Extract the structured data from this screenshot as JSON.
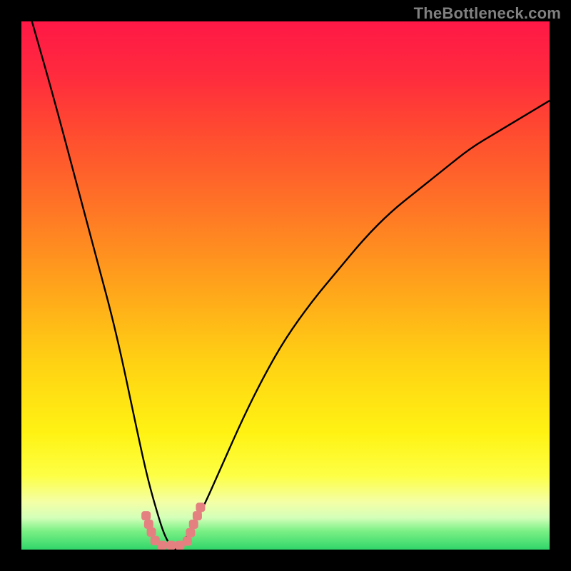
{
  "watermark": "TheBottleneck.com",
  "colors": {
    "frame": "#000000",
    "curve": "#000000",
    "marker": "#e58080",
    "bottom_band": "#31d66b",
    "gradient_stops": [
      {
        "offset": "0%",
        "color": "#ff1846"
      },
      {
        "offset": "10%",
        "color": "#ff2a3e"
      },
      {
        "offset": "20%",
        "color": "#ff4831"
      },
      {
        "offset": "35%",
        "color": "#ff7426"
      },
      {
        "offset": "50%",
        "color": "#ffa31b"
      },
      {
        "offset": "65%",
        "color": "#ffd313"
      },
      {
        "offset": "78%",
        "color": "#fff313"
      },
      {
        "offset": "86%",
        "color": "#fdff45"
      },
      {
        "offset": "91%",
        "color": "#f4ffa6"
      },
      {
        "offset": "94%",
        "color": "#d3ffb9"
      },
      {
        "offset": "96.5%",
        "color": "#7af084"
      },
      {
        "offset": "100%",
        "color": "#31d66b"
      }
    ]
  },
  "chart_data": {
    "type": "line",
    "title": "",
    "xlabel": "",
    "ylabel": "",
    "xlim": [
      0,
      100
    ],
    "ylim": [
      0,
      100
    ],
    "grid": false,
    "series": [
      {
        "name": "bottleneck-curve",
        "x": [
          2,
          6,
          10,
          14,
          18,
          22,
          24,
          26,
          27,
          28,
          29,
          30,
          31,
          34,
          38,
          42,
          46,
          50,
          55,
          60,
          65,
          70,
          75,
          80,
          85,
          90,
          95,
          100
        ],
        "y": [
          100,
          86,
          71,
          56,
          41,
          22,
          13,
          6,
          3,
          1,
          0,
          0,
          2,
          7,
          16,
          25,
          33,
          40,
          47,
          53,
          59,
          64,
          68,
          72,
          76,
          79,
          82,
          85
        ]
      }
    ],
    "markers": [
      {
        "x": 23.6,
        "y": 6.4
      },
      {
        "x": 24.1,
        "y": 4.8
      },
      {
        "x": 24.6,
        "y": 3.3
      },
      {
        "x": 25.3,
        "y": 1.7
      },
      {
        "x": 26.6,
        "y": 0.8
      },
      {
        "x": 28.3,
        "y": 0.8
      },
      {
        "x": 30.0,
        "y": 0.8
      },
      {
        "x": 31.4,
        "y": 1.6
      },
      {
        "x": 32.0,
        "y": 3.2
      },
      {
        "x": 32.6,
        "y": 4.8
      },
      {
        "x": 33.3,
        "y": 6.4
      },
      {
        "x": 33.9,
        "y": 8.0
      }
    ],
    "notes": "Values are approximate; read off normalized 0–100 axes from a watermark-only chart with no visible ticks. Minimum near x≈29."
  }
}
